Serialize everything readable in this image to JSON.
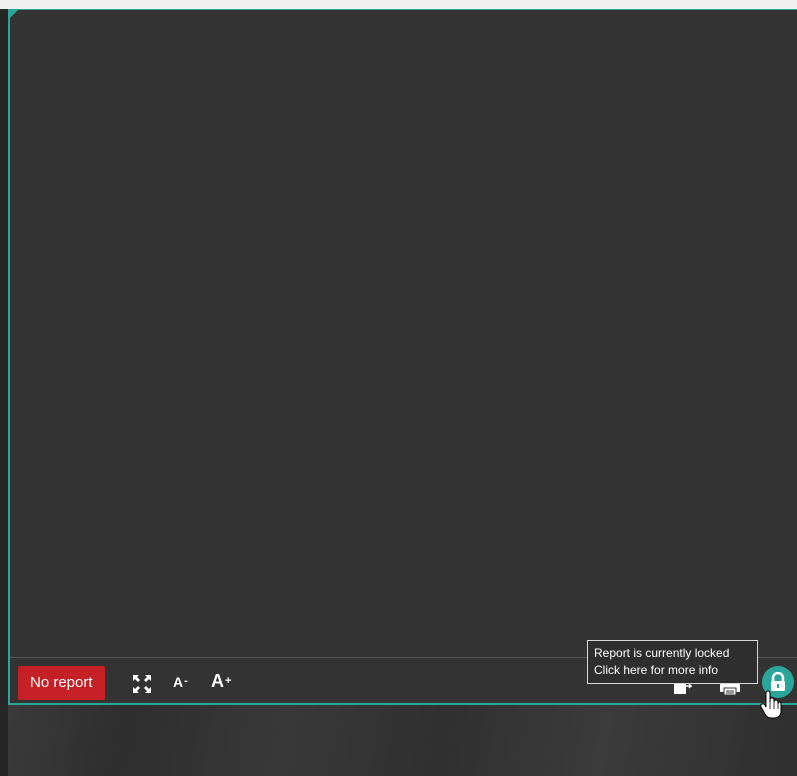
{
  "toolbar": {
    "no_report_label": "No report",
    "font_decrease_label": "A",
    "font_decrease_suffix": "-",
    "font_increase_label": "A",
    "font_increase_suffix": "+",
    "icons": [
      "fullscreen-icon",
      "export-icon",
      "print-icon",
      "lock-icon"
    ]
  },
  "tooltip": {
    "line1": "Report is currently locked",
    "line2": "Click here for more info"
  },
  "colors": {
    "accent": "#2aa59a",
    "no_report": "#c42026",
    "panel": "#333333"
  }
}
